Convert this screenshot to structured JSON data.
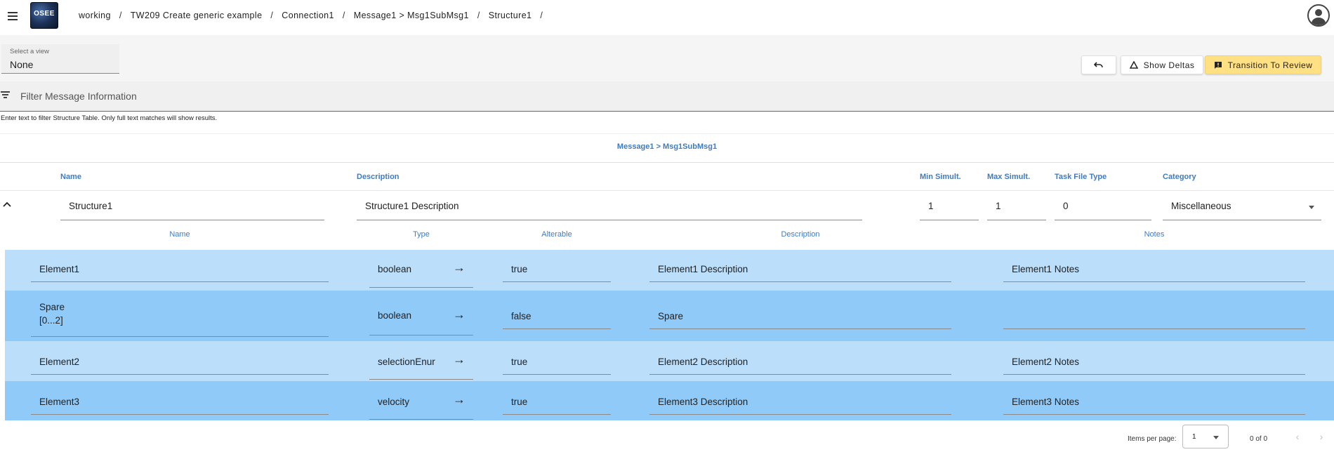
{
  "app": {
    "logo_text": "OSEE"
  },
  "breadcrumb": [
    "working",
    "TW209 Create generic example",
    "Connection1",
    "Message1 > Msg1SubMsg1",
    "Structure1"
  ],
  "view_select": {
    "label": "Select a view",
    "value": "None"
  },
  "actions": {
    "show_deltas": "Show Deltas",
    "transition": "Transition To Review"
  },
  "filter": {
    "placeholder": "Filter Message Information",
    "hint": "Enter text to filter Structure Table. Only full text matches will show results."
  },
  "message_title": "Message1 > Msg1SubMsg1",
  "structure_headers": {
    "name": "Name",
    "description": "Description",
    "min": "Min Simult.",
    "max": "Max Simult.",
    "task": "Task File Type",
    "category": "Category"
  },
  "structure": {
    "name": "Structure1",
    "description": "Structure1 Description",
    "min": "1",
    "max": "1",
    "task": "0",
    "category": "Miscellaneous"
  },
  "element_headers": {
    "name": "Name",
    "type": "Type",
    "alterable": "Alterable",
    "description": "Description",
    "notes": "Notes"
  },
  "elements": [
    {
      "name": "Element1",
      "name2": "",
      "type": "boolean",
      "alterable": "true",
      "description": "Element1 Description",
      "notes": "Element1 Notes"
    },
    {
      "name": "Spare",
      "name2": "[0...2]",
      "type": "boolean",
      "alterable": "false",
      "description": "Spare",
      "notes": ""
    },
    {
      "name": "Element2",
      "name2": "",
      "type": "selectionEnur",
      "alterable": "true",
      "description": "Element2 Description",
      "notes": "Element2 Notes"
    },
    {
      "name": "Element3",
      "name2": "",
      "type": "velocity",
      "alterable": "true",
      "description": "Element3 Description",
      "notes": "Element3 Notes"
    }
  ],
  "pager": {
    "label": "Items per page:",
    "per_page": "1",
    "range": "0 of 0"
  },
  "colors": {
    "accent": "#3f7bbf",
    "row_light": "#bbdefb",
    "row_dark": "#90caf9",
    "review_button": "#ffe082"
  },
  "icons": [
    "menu-icon",
    "account-circle-icon",
    "undo-icon",
    "delta-icon",
    "review-icon",
    "filter-icon",
    "chevron-up-icon",
    "arrow-right-icon",
    "chevron-left-icon",
    "chevron-right-icon"
  ]
}
